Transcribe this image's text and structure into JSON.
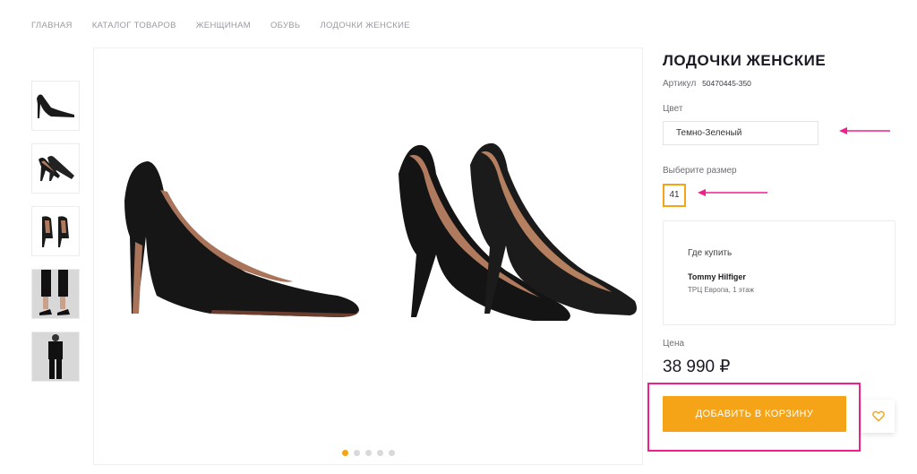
{
  "breadcrumb": [
    "ГЛАВНАЯ",
    "КАТАЛОГ ТОВАРОВ",
    "ЖЕНЩИНАМ",
    "ОБУВЬ",
    "ЛОДОЧКИ ЖЕНСКИЕ"
  ],
  "product": {
    "title": "ЛОДОЧКИ ЖЕНСКИЕ",
    "article_label": "Артикул",
    "article_value": "50470445-350",
    "color_label": "Цвет",
    "color_value": "Темно-Зеленый",
    "size_label": "Выберите размер",
    "size_value": "41",
    "price_label": "Цена",
    "price": "38 990 ₽"
  },
  "where_to_buy": {
    "title": "Где купить",
    "store_name": "Tommy Hilfiger",
    "store_address": "ТРЦ Европа, 1 этаж"
  },
  "actions": {
    "add_to_cart": "ДОБАВИТЬ В КОРЗИНУ"
  },
  "gallery": {
    "thumbnail_count": 5,
    "dot_count": 5,
    "active_index": 0
  },
  "colors": {
    "accent": "#f5a417",
    "highlight": "#ef1f8e",
    "arrow": "#ef1f8e"
  },
  "icons": {
    "favorite": "heart-icon"
  }
}
